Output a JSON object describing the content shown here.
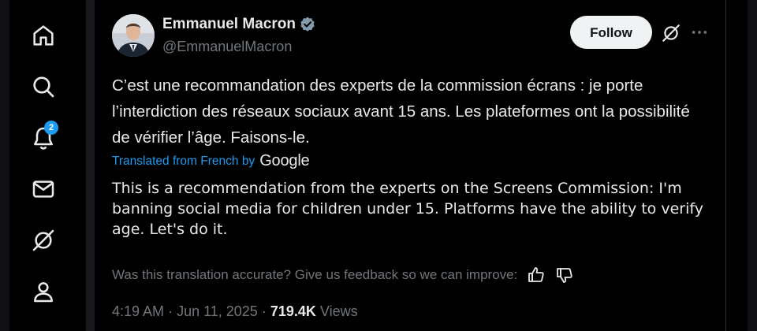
{
  "nav": {
    "items": [
      {
        "icon": "home-icon"
      },
      {
        "icon": "search-icon"
      },
      {
        "icon": "notifications-icon",
        "badge": "2"
      },
      {
        "icon": "messages-icon"
      },
      {
        "icon": "grok-icon"
      },
      {
        "icon": "profile-icon"
      }
    ]
  },
  "tweet": {
    "author_name": "Emmanuel Macron",
    "author_handle": "@EmmanuelMacron",
    "verified": true,
    "follow_label": "Follow",
    "text": "C’est une recommandation des experts de la commission écrans : je porte l’interdiction des réseaux sociaux avant 15 ans. Les plateformes ont la possibilité de vérifier l’âge. Faisons-le.",
    "translated_label": "Translated from French by",
    "translator": "Google",
    "translated_text": "This is a recommendation from the experts on the Screens Commission: I'm banning social media for children under 15. Platforms have the ability to verify age. Let's do it.",
    "feedback_text": "Was this translation accurate? Give us feedback so we can improve:",
    "time": "4:19 AM",
    "date": "Jun 11, 2025",
    "views_count": "719.4K",
    "views_label": "Views"
  },
  "colors": {
    "accent": "#1d9bf0",
    "text_primary": "#e7e9ea",
    "text_secondary": "#71767b",
    "background": "#000000"
  }
}
